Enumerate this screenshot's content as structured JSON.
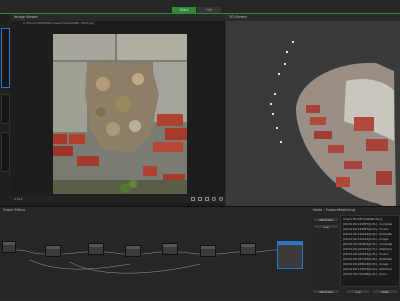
{
  "tabs": [
    {
      "label": "Start",
      "active": true
    },
    {
      "label": "Edit",
      "active": false
    }
  ],
  "image_viewer": {
    "title": "Image Viewer",
    "path": "C:/Photo/3DMODEL/mesh23/data/IMG_0043.jpg",
    "filename": "IMG_0043.JPG",
    "zoom": "0.51x"
  },
  "viewer3d": {
    "title": "3D Viewer"
  },
  "graph": {
    "title": "Graph Editor"
  },
  "node_panel": {
    "header": "Node - FeatureMatching",
    "tabs": [
      "Attributes",
      "Log"
    ],
    "log_lines": [
      "Graph: BuildFrameMatching",
      "[00:01:09.143957][info] - Compute",
      "[00:01:09.144087][info] - Found",
      "[00:01:09.144192][info] - Estimate",
      "[00:01:09.144214][info] - Image",
      "[00:01:09.161022][info] - Compute",
      "[00:01:09.164513][info] - Matched",
      "[00:01:09.165212][info] - Found",
      "[00:01:09.167319][info] - Estimate",
      "[00:01:09.168104][info] - Image",
      "[00:01:09.170533][info] - Matched",
      "[00:01:09.172208][info] - Done"
    ],
    "buttons": [
      "Attributes",
      "Log",
      "Stats"
    ]
  },
  "colors": {
    "accent": "#2f8a3a",
    "node_blue": "#2a78c2",
    "panel_bg": "#1d1d1d"
  }
}
